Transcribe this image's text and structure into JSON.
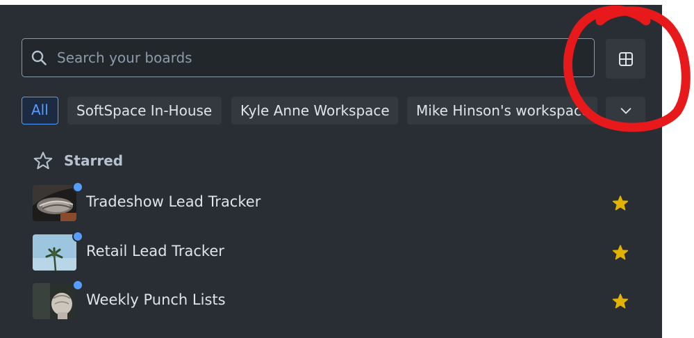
{
  "search": {
    "placeholder": "Search your boards"
  },
  "filters": {
    "items": [
      {
        "label": "All",
        "active": true
      },
      {
        "label": "SoftSpace In-House",
        "active": false
      },
      {
        "label": "Kyle Anne Workspace",
        "active": false
      },
      {
        "label": "Mike Hinson's workspace",
        "active": false
      }
    ]
  },
  "starred": {
    "title": "Starred",
    "boards": [
      {
        "name": "Tradeshow Lead Tracker",
        "thumb": "tradeshow-thumbnail"
      },
      {
        "name": "Retail Lead Tracker",
        "thumb": "palm-tree-thumbnail"
      },
      {
        "name": "Weekly Punch Lists",
        "thumb": "fist-thumbnail"
      }
    ]
  },
  "colors": {
    "background": "#282e33",
    "accent": "#579dff",
    "star": "#e2b203",
    "annotation": "#e8191b"
  }
}
